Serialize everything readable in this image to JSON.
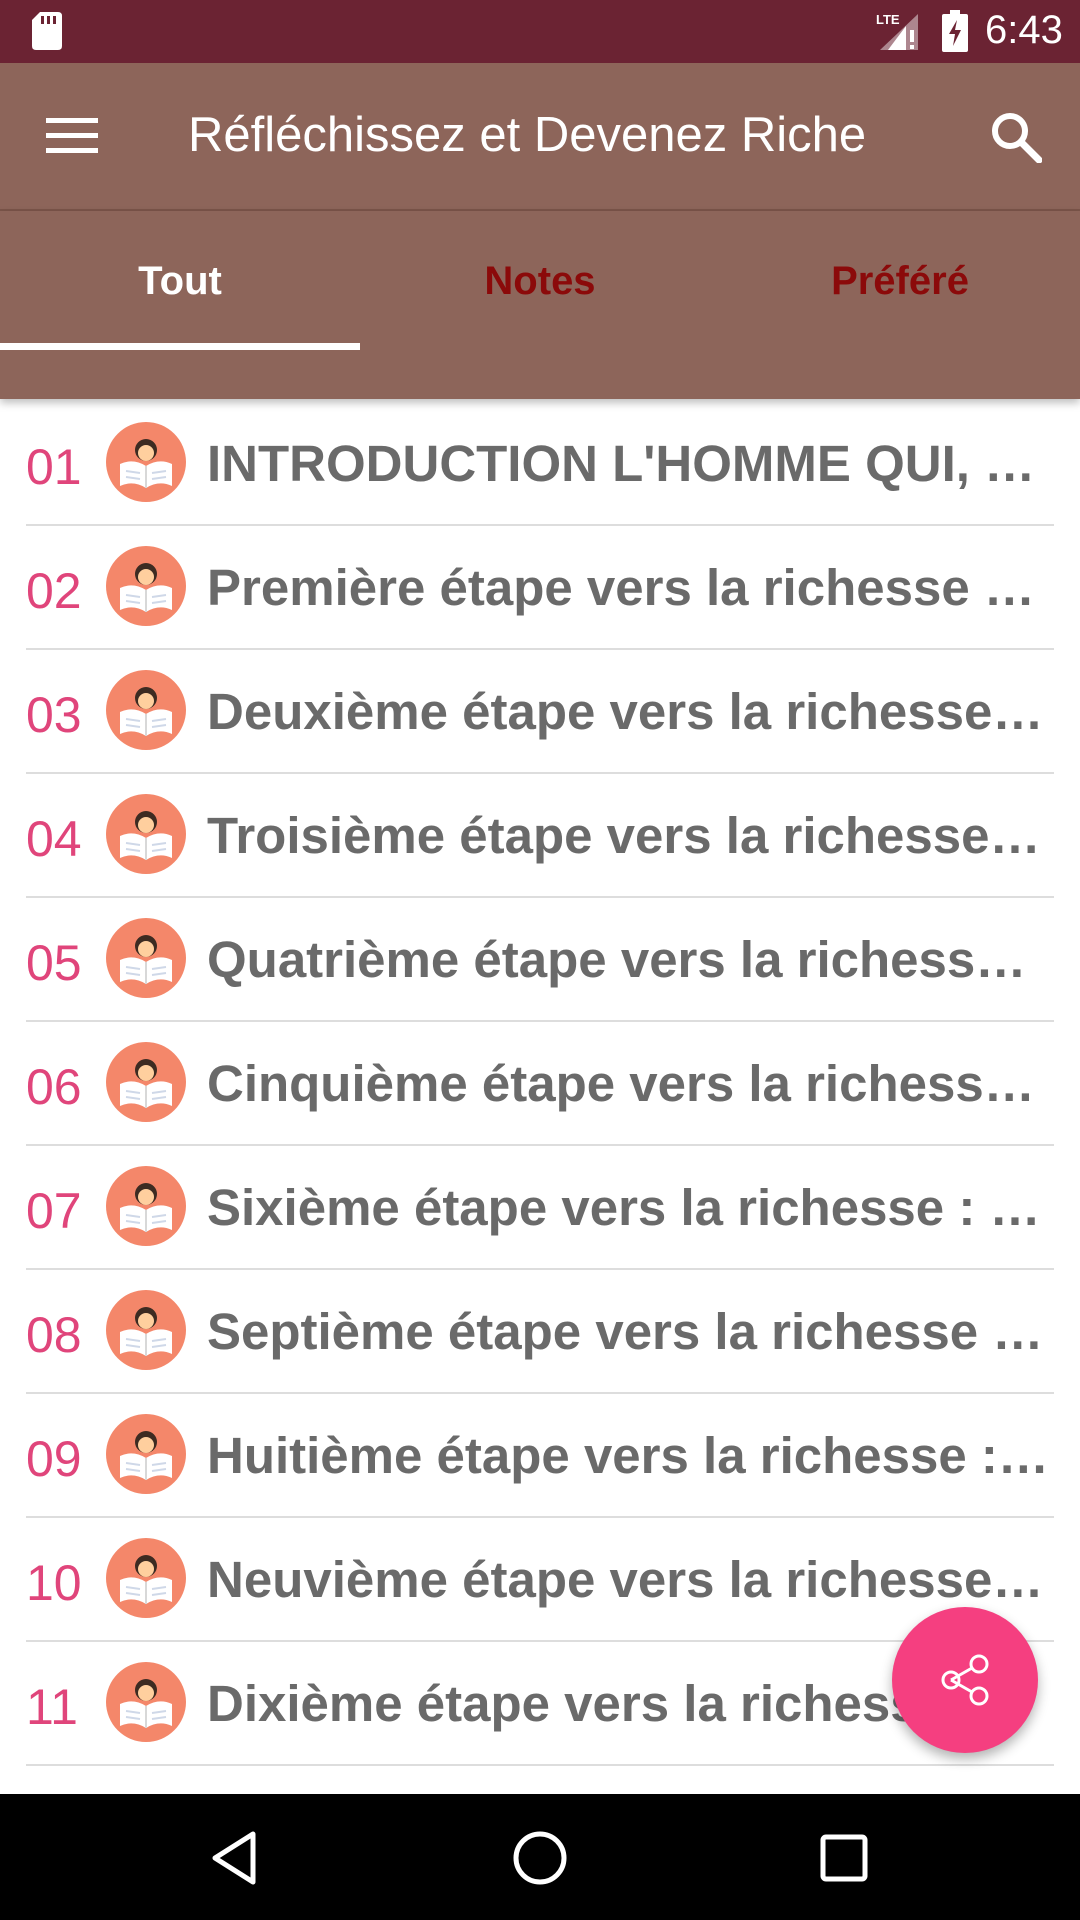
{
  "status_bar": {
    "time": "6:43",
    "network_label": "LTE",
    "icons": [
      "sd-card-icon",
      "lte-signal-icon",
      "battery-charging-icon"
    ]
  },
  "app_bar": {
    "title": "Réfléchissez et Devenez Riche",
    "icons": [
      "menu-icon",
      "search-icon"
    ]
  },
  "tabs": [
    {
      "label": "Tout",
      "active": true
    },
    {
      "label": "Notes",
      "active": false
    },
    {
      "label": "Préféré",
      "active": false
    }
  ],
  "chapters": [
    {
      "number": "01",
      "title": "INTRODUCTION L'HOMME QUI, “D…"
    },
    {
      "number": "02",
      "title": "Première étape vers la richesse L…"
    },
    {
      "number": "03",
      "title": "Deuxième étape vers la richesse:…"
    },
    {
      "number": "04",
      "title": "Troisième étape vers la richesse :…"
    },
    {
      "number": "05",
      "title": "Quatrième étape vers la richesse…"
    },
    {
      "number": "06",
      "title": "Cinquième étape vers la richesse…"
    },
    {
      "number": "07",
      "title": "Sixième étape vers la richesse : L'…"
    },
    {
      "number": "08",
      "title": "Septième étape vers la richesse :…"
    },
    {
      "number": "09",
      "title": "Huitième étape vers la richesse :…"
    },
    {
      "number": "10",
      "title": "Neuvième étape vers la richesse :…"
    },
    {
      "number": "11",
      "title": "Dixième étape vers la richesse :…"
    }
  ],
  "fab": {
    "icon": "share-icon"
  },
  "nav_bar": {
    "icons": [
      "back-icon",
      "home-icon",
      "recents-icon"
    ]
  },
  "colors": {
    "status_bar": "#6b2333",
    "app_bar": "#8d655a",
    "tab_inactive_text": "#8b0a0a",
    "number_accent": "#e0457b",
    "fab": "#f53f80",
    "item_icon_bg": "#f4876a"
  }
}
